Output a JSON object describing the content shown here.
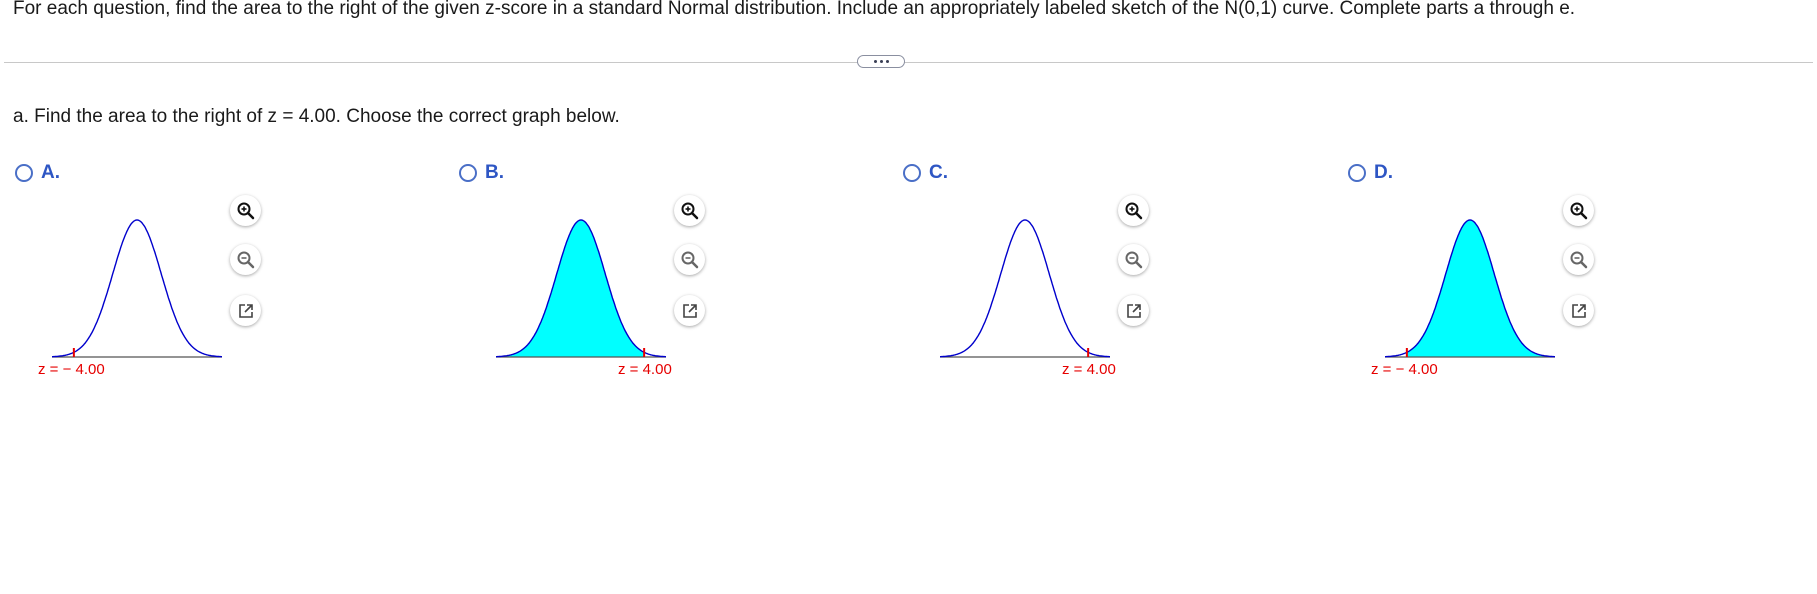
{
  "instructions": "For each question, find the area to the right of the given z-score in a standard Normal distribution. Include an appropriately labeled sketch of the N(0,1) curve. Complete parts a through e.",
  "question_a": "a. Find the area to the right of z = 4.00. Choose the correct graph below.",
  "colors": {
    "shade": "#00ffff",
    "curve": "#0000cc",
    "marker": "#e60000",
    "radio": "#4a6fc7",
    "letter": "#2e56c4"
  },
  "icons": {
    "more": "ellipsis-icon",
    "zoom_in": "zoom-in-icon",
    "zoom_out": "zoom-out-icon",
    "popout": "popout-icon"
  },
  "options": [
    {
      "letter": "A.",
      "z_label": "z = − 4.00",
      "z_value": -4.0,
      "shaded_side": "none"
    },
    {
      "letter": "B.",
      "z_label": "z = 4.00",
      "z_value": 4.0,
      "shaded_side": "left"
    },
    {
      "letter": "C.",
      "z_label": "z = 4.00",
      "z_value": 4.0,
      "shaded_side": "none"
    },
    {
      "letter": "D.",
      "z_label": "z = − 4.00",
      "z_value": -4.0,
      "shaded_side": "right"
    }
  ]
}
